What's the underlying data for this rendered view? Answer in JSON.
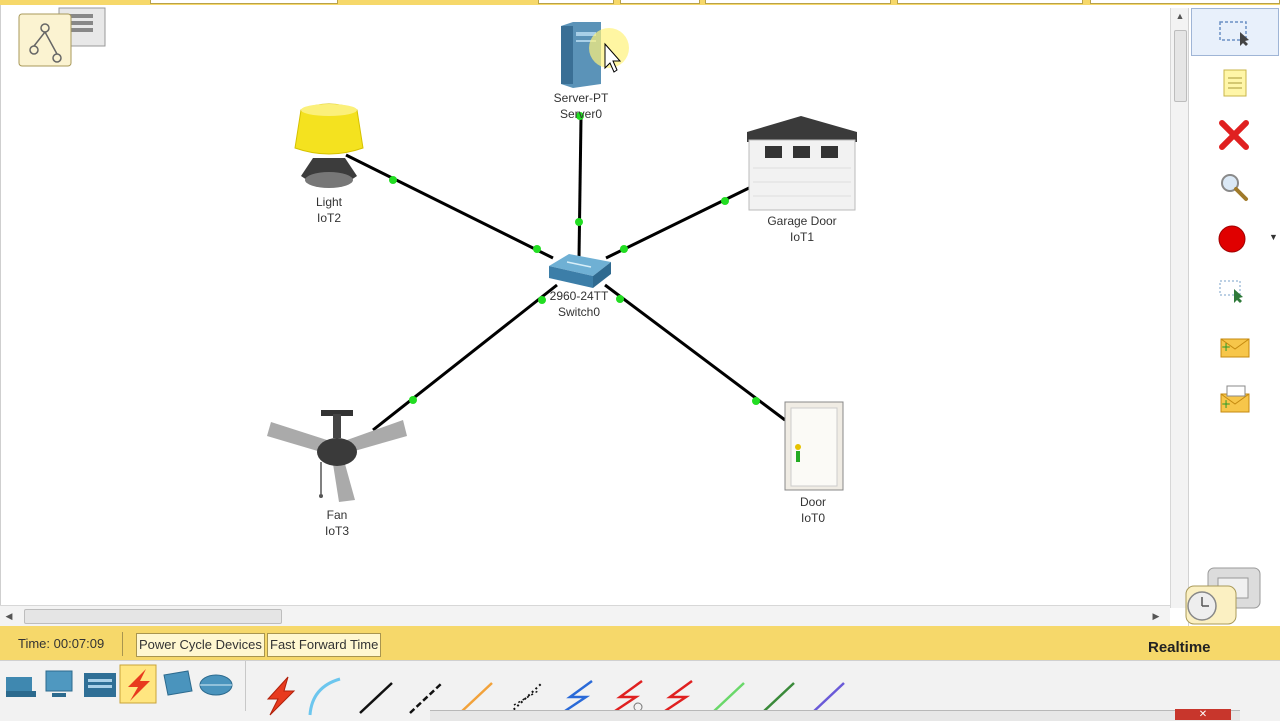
{
  "devices": [
    {
      "id": "server",
      "type": "Server-PT",
      "name": "Server0"
    },
    {
      "id": "light",
      "type": "Light",
      "name": "IoT2"
    },
    {
      "id": "garage",
      "type": "Garage Door",
      "name": "IoT1"
    },
    {
      "id": "switch",
      "type": "2960-24TT",
      "name": "Switch0"
    },
    {
      "id": "fan",
      "type": "Fan",
      "name": "IoT3"
    },
    {
      "id": "door",
      "type": "Door",
      "name": "IoT0"
    }
  ],
  "status": {
    "time_label": "Time: 00:07:09",
    "power_cycle_label": "Power Cycle Devices",
    "fast_forward_label": "Fast Forward Time",
    "mode_label": "Realtime"
  },
  "colors": {
    "toolbar_yellow": "#f6d86a",
    "link_green": "#22dd22",
    "delete_red": "#e02020",
    "pdu_red": "#e00000"
  },
  "right_tools": [
    "select-icon",
    "note-icon",
    "delete-icon",
    "inspect-icon",
    "draw-ellipse-icon",
    "resize-icon",
    "simple-pdu-icon",
    "complex-pdu-icon"
  ],
  "device_categories": [
    "network-devices-icon",
    "end-devices-icon",
    "components-icon",
    "connections-icon",
    "miscellaneous-icon",
    "multiuser-icon"
  ],
  "connection_types": [
    "automatic-connection-icon",
    "console-cable-icon",
    "copper-straight-through-icon",
    "copper-cross-over-icon",
    "fiber-icon",
    "phone-cable-icon",
    "coaxial-cable-icon",
    "serial-dce-icon",
    "serial-dte-icon",
    "octal-cable-icon",
    "iot-custom-cable-icon",
    "usb-cable-icon"
  ]
}
